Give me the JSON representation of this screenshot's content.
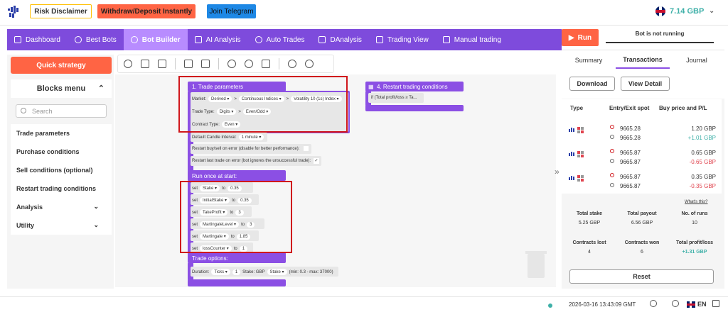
{
  "header": {
    "risk_label": "Risk Disclaimer",
    "withdraw_label": "Withdraw/Deposit Instantly",
    "telegram_label": "Join Telegram",
    "balance": "7.14 GBP"
  },
  "nav": {
    "items": [
      {
        "label": "Dashboard"
      },
      {
        "label": "Best Bots"
      },
      {
        "label": "Bot Builder"
      },
      {
        "label": "AI Analysis"
      },
      {
        "label": "Auto Trades"
      },
      {
        "label": "DAnalysis"
      },
      {
        "label": "Trading View"
      },
      {
        "label": "Manual trading"
      }
    ]
  },
  "run": {
    "label": "Run",
    "status": "Bot is not running"
  },
  "left": {
    "quick_label": "Quick strategy",
    "blocks_title": "Blocks menu",
    "search_placeholder": "Search",
    "items": [
      {
        "label": "Trade parameters"
      },
      {
        "label": "Purchase conditions"
      },
      {
        "label": "Sell conditions (optional)"
      },
      {
        "label": "Restart trading conditions"
      },
      {
        "label": "Analysis"
      },
      {
        "label": "Utility"
      }
    ]
  },
  "blocks": {
    "trade_params_title": "1. Trade parameters",
    "market_label": "Market:",
    "market_1": "Derived",
    "market_2": "Continuous Indices",
    "market_3": "Volatility 10 (1s) Index",
    "trade_type_label": "Trade Type:",
    "trade_type_1": "Digits",
    "trade_type_2": "Even/Odd",
    "contract_type_label": "Contract Type:",
    "contract_type": "Even",
    "candle_label": "Default Candle Interval:",
    "candle_value": "1 minute",
    "restart_buysell": "Restart buy/sell on error (disable for better performance):",
    "restart_last": "Restart last trade on error (bot ignores the unsuccessful trade):",
    "run_once": "Run once at start:",
    "set_word": "set",
    "to_word": "to",
    "vars": [
      {
        "name": "Stake",
        "value": "0.35"
      },
      {
        "name": "InitialStake",
        "value": "0.35"
      },
      {
        "name": "TakeProfit",
        "value": "3"
      },
      {
        "name": "MartingaleLevel",
        "value": "3"
      },
      {
        "name": "Martingale",
        "value": "1.85"
      },
      {
        "name": "lossCounter",
        "value": "1"
      }
    ],
    "trade_options": "Trade options:",
    "duration_label": "Duration:",
    "duration_unit": "Ticks",
    "duration_value": "1",
    "stake_label": "Stake: GBP",
    "stake_select": "Stake",
    "range_note": "(min: 0.3 - max: 37000)",
    "restart_title": "4. Restart trading conditions",
    "restart_if": "if (Total profit/loss ≥ Ta..."
  },
  "right": {
    "tabs": [
      {
        "label": "Summary"
      },
      {
        "label": "Transactions"
      },
      {
        "label": "Journal"
      }
    ],
    "download": "Download",
    "view_detail": "View Detail",
    "col_type": "Type",
    "col_spot": "Entry/Exit spot",
    "col_price": "Buy price and P/L",
    "rows": [
      {
        "entry": "9665.28",
        "exit": "9665.28",
        "buy": "1.20 GBP",
        "pl": "+1.01 GBP",
        "pl_color": "#3eb0a8"
      },
      {
        "entry": "9665.87",
        "exit": "9665.87",
        "buy": "0.65 GBP",
        "pl": "-0.65 GBP",
        "pl_color": "#e0444f"
      },
      {
        "entry": "9665.87",
        "exit": "9665.87",
        "buy": "0.35 GBP",
        "pl": "-0.35 GBP",
        "pl_color": "#e0444f"
      }
    ],
    "whats_this": "What's this?",
    "stats": [
      {
        "label": "Total stake",
        "value": "5.25 GBP"
      },
      {
        "label": "Total payout",
        "value": "6.56 GBP"
      },
      {
        "label": "No. of runs",
        "value": "10"
      },
      {
        "label": "Contracts lost",
        "value": "4"
      },
      {
        "label": "Contracts won",
        "value": "6"
      },
      {
        "label": "Total profit/loss",
        "value": "+1.31 GBP"
      }
    ],
    "reset": "Reset"
  },
  "footer": {
    "time": "2026-03-16 13:43:09 GMT",
    "lang": "EN"
  },
  "colors": {
    "purple": "#7e4bdc",
    "orange": "#ff6444",
    "green": "#3eb0a8",
    "red": "#d0171c"
  }
}
